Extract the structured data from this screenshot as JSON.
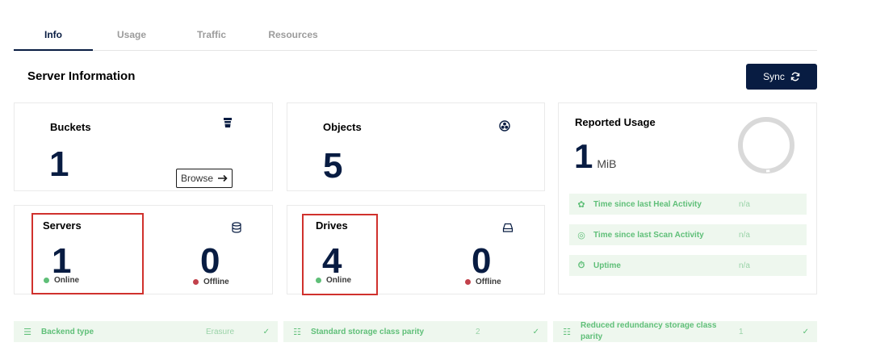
{
  "tabs": [
    "Info",
    "Usage",
    "Traffic",
    "Resources"
  ],
  "section_title": "Server Information",
  "sync_button": "Sync",
  "buckets": {
    "title": "Buckets",
    "count": "1",
    "browse_label": "Browse"
  },
  "objects": {
    "title": "Objects",
    "count": "5"
  },
  "reported_usage": {
    "title": "Reported Usage",
    "value": "1",
    "unit": "MiB"
  },
  "servers": {
    "title": "Servers",
    "online_count": "1",
    "online_label": "Online",
    "offline_count": "0",
    "offline_label": "Offline"
  },
  "drives": {
    "title": "Drives",
    "online_count": "4",
    "online_label": "Online",
    "offline_count": "0",
    "offline_label": "Offline"
  },
  "activity": [
    {
      "label": "Time since last Heal Activity",
      "value": "n/a",
      "icon": "heal-icon"
    },
    {
      "label": "Time since last Scan Activity",
      "value": "n/a",
      "icon": "scan-icon"
    },
    {
      "label": "Uptime",
      "value": "n/a",
      "icon": "uptime-icon"
    }
  ],
  "bottom": {
    "backend_label": "Backend type",
    "backend_value": "Erasure",
    "standard_label": "Standard storage class parity",
    "standard_value": "2",
    "reduced_label": "Reduced redundancy storage class parity",
    "reduced_value": "1"
  },
  "colors": {
    "navy": "#081c42",
    "online": "#5fbf78",
    "offline": "#c2414b",
    "highlight": "#d0312d",
    "light_green_bg": "#eef7ee"
  }
}
